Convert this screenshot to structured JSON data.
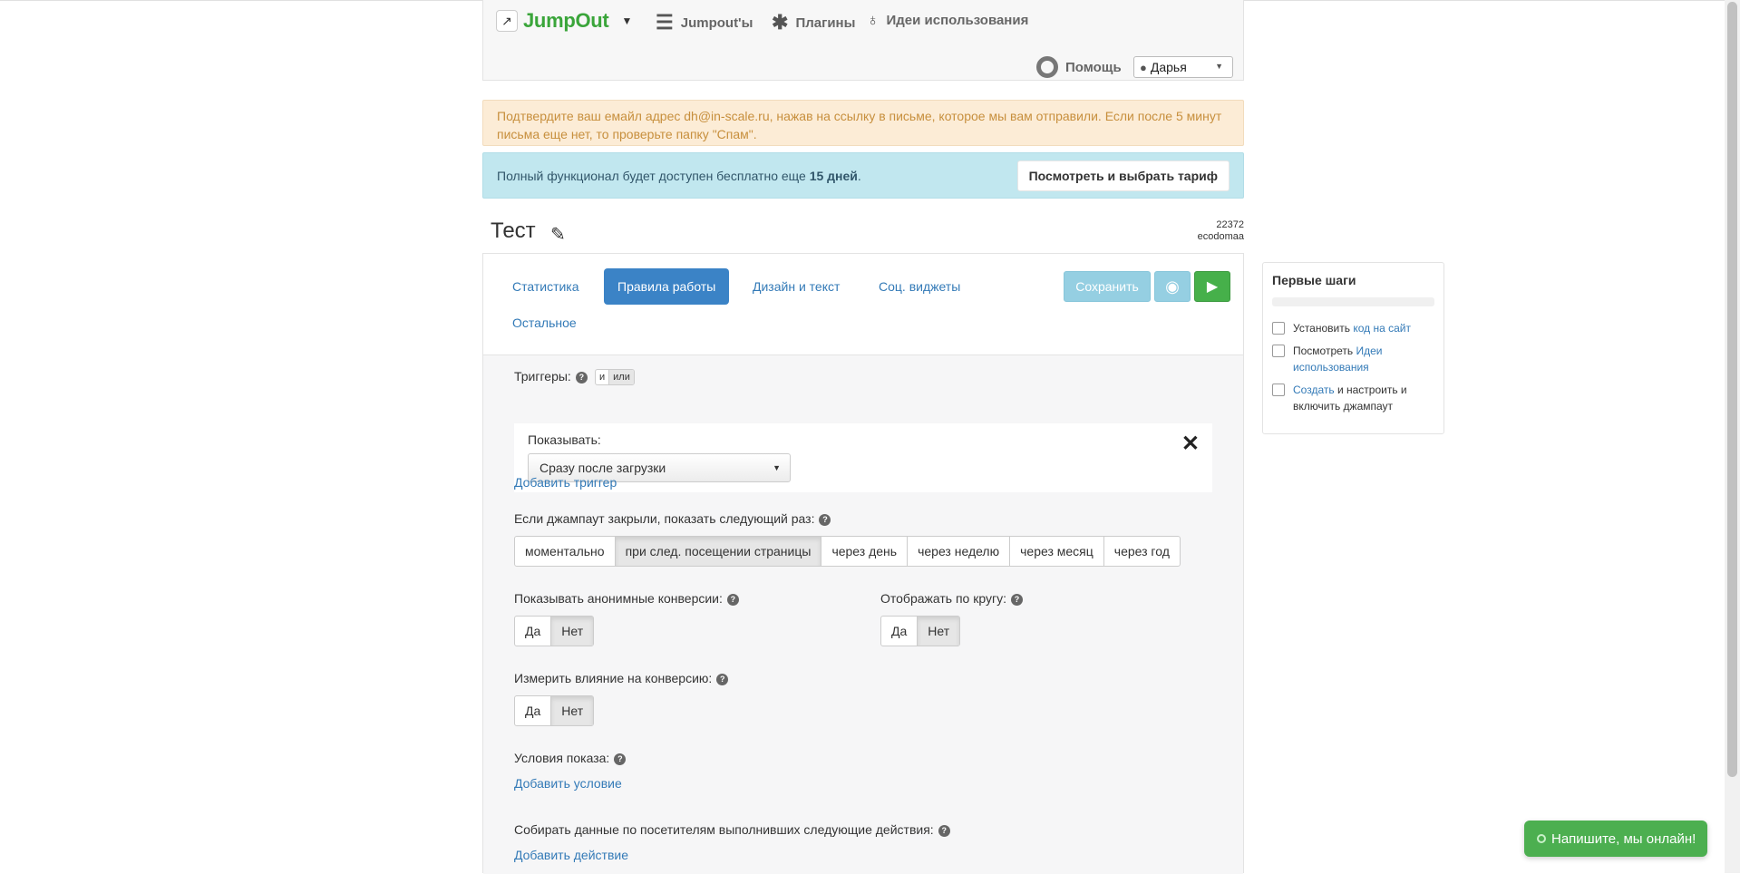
{
  "header": {
    "brand": "JumpOut",
    "nav": [
      {
        "label": "Jumpout'ы",
        "icon": "list-icon"
      },
      {
        "label": "Плагины",
        "icon": "puzzle-icon"
      },
      {
        "label": "Идеи использования",
        "icon": "lightbulb-icon"
      }
    ],
    "help_label": "Помощь",
    "user_name": "Дарья"
  },
  "alerts": {
    "email_confirm": "Подтвердите ваш емайл адрес dh@in-scale.ru, нажав на ссылку в письме, которое мы вам отправили. Если после 5 минут письма еще нет, то проверьте папку \"Спам\".",
    "trial_prefix": "Полный функционал будет доступен бесплатно еще ",
    "trial_days": "15 дней",
    "trial_suffix": ".",
    "trial_button": "Посмотреть и выбрать тариф"
  },
  "page": {
    "title": "Тест",
    "id": "22372",
    "site": "ecodomaa"
  },
  "tabs": [
    {
      "label": "Статистика",
      "active": false
    },
    {
      "label": "Правила работы",
      "active": true
    },
    {
      "label": "Дизайн и текст",
      "active": false
    },
    {
      "label": "Соц. виджеты",
      "active": false
    },
    {
      "label": "Остальное",
      "active": false
    }
  ],
  "actions": {
    "save": "Сохранить"
  },
  "rules": {
    "triggers_label": "Триггеры:",
    "logic_and": "и",
    "logic_or": "или",
    "show_label": "Показывать:",
    "show_selected": "Сразу после загрузки",
    "add_trigger": "Добавить триггер",
    "if_closed_label": "Если джампаут закрыли, показать следующий раз:",
    "if_closed_options": [
      "моментально",
      "при след. посещении страницы",
      "через день",
      "через неделю",
      "через месяц",
      "через год"
    ],
    "if_closed_selected": "при след. посещении страницы",
    "anon_conv_label": "Показывать анонимные конверсии:",
    "circle_label": "Отображать по кругу:",
    "measure_label": "Измерить влияние на конверсию:",
    "yes": "Да",
    "no": "Нет",
    "conditions_label": "Условия показа:",
    "add_condition": "Добавить условие",
    "collect_label": "Собирать данные по посетителям выполнивших следующие действия:",
    "add_action": "Добавить действие"
  },
  "first_steps": {
    "title": "Первые шаги",
    "progress": 0,
    "steps": [
      {
        "pre": "Установить ",
        "link": "код на сайт",
        "post": ""
      },
      {
        "pre": "Посмотреть ",
        "link": "Идеи использования",
        "post": ""
      },
      {
        "pre": "",
        "link": "Создать",
        "post": " и настроить и включить джампаут"
      }
    ]
  },
  "chat": {
    "label": "Напишите, мы онлайн!"
  }
}
